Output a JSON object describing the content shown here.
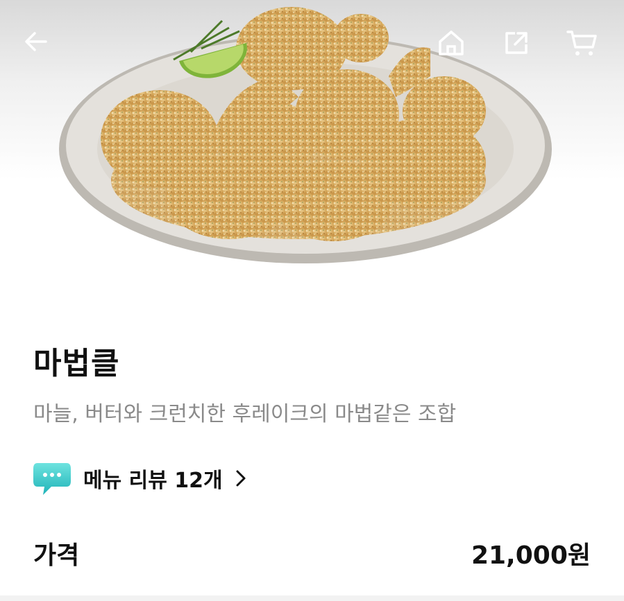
{
  "menu": {
    "name": "마법클",
    "description": "마늘, 버터와 크런치한 후레이크의 마법같은 조합",
    "image_icon": "fried-chicken-plate"
  },
  "review": {
    "label": "메뉴 리뷰 12개",
    "icon": "chat-bubble-icon",
    "accent_color": "#36c9c9"
  },
  "price": {
    "label": "가격",
    "value": "21,000원"
  },
  "nav": {
    "back_icon": "arrow-left-icon",
    "home_icon": "home-icon",
    "share_icon": "share-icon",
    "cart_icon": "cart-icon"
  }
}
